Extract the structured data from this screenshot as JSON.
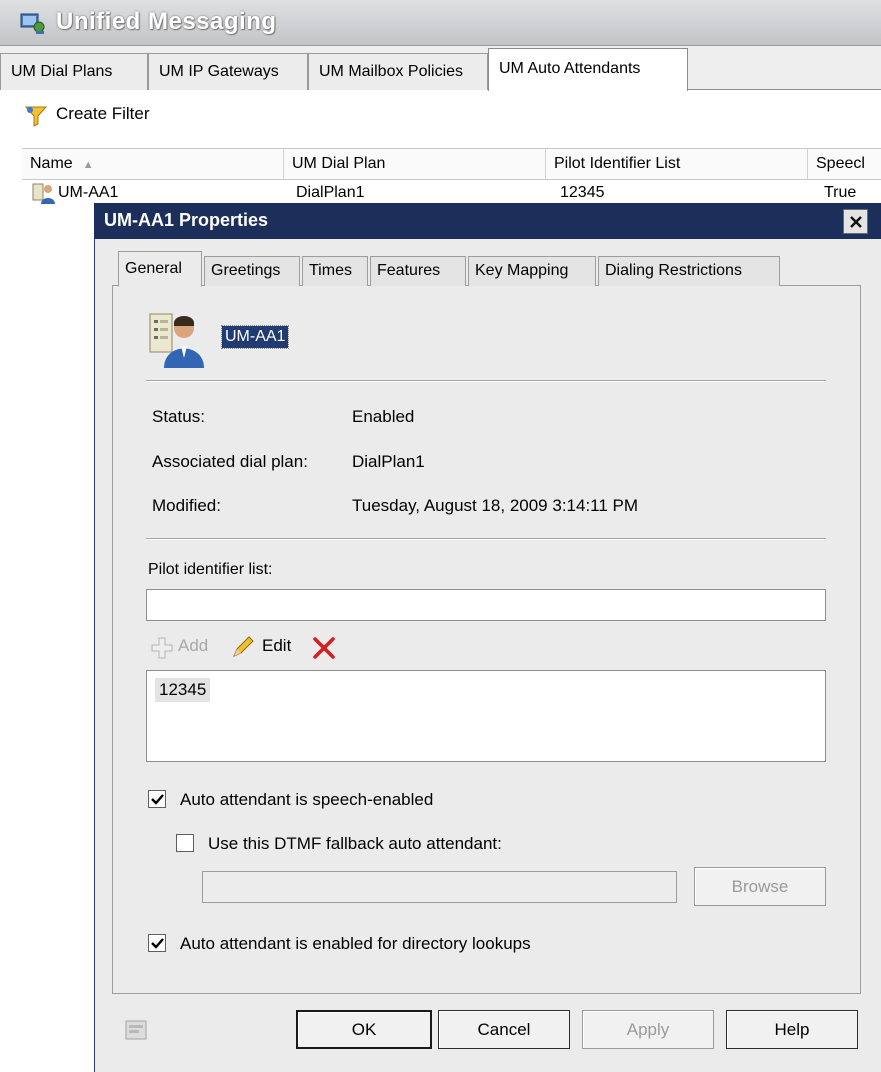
{
  "window": {
    "title": "Unified Messaging",
    "tabs": [
      "UM Dial Plans",
      "UM IP Gateways",
      "UM Mailbox Policies",
      "UM Auto Attendants"
    ],
    "toolbar": {
      "create_filter_label": "Create Filter"
    },
    "list": {
      "columns": [
        "Name",
        "UM Dial Plan",
        "Pilot Identifier List",
        "Speecl"
      ],
      "rows": [
        {
          "name": "UM-AA1",
          "dial_plan": "DialPlan1",
          "pilot": "12345",
          "speech": "True"
        }
      ]
    }
  },
  "dialog": {
    "title": "UM-AA1 Properties",
    "tabs": [
      "General",
      "Greetings",
      "Times",
      "Features",
      "Key Mapping",
      "Dialing Restrictions"
    ],
    "object_name": "UM-AA1",
    "fields": {
      "status_label": "Status:",
      "status_value": "Enabled",
      "dialplan_label": "Associated dial plan:",
      "dialplan_value": "DialPlan1",
      "modified_label": "Modified:",
      "modified_value": "Tuesday, August 18, 2009 3:14:11 PM"
    },
    "pilot": {
      "label": "Pilot identifier list:",
      "input_value": "",
      "add_label": "Add",
      "edit_label": "Edit",
      "items": [
        "12345"
      ]
    },
    "checks": {
      "speech_enabled": {
        "label": "Auto attendant is speech-enabled",
        "checked": true
      },
      "dtmf_fallback": {
        "label": "Use this DTMF fallback auto attendant:",
        "checked": false
      },
      "fallback_value": "",
      "browse_label": "Browse",
      "directory_lookups": {
        "label": "Auto attendant is enabled for directory lookups",
        "checked": true
      }
    },
    "buttons": {
      "ok": "OK",
      "cancel": "Cancel",
      "apply": "Apply",
      "help": "Help"
    }
  },
  "colors": {
    "dialog_title_bg": "#1c2f5a",
    "selection_bg": "#1f3b72",
    "delete_red": "#d42020"
  }
}
